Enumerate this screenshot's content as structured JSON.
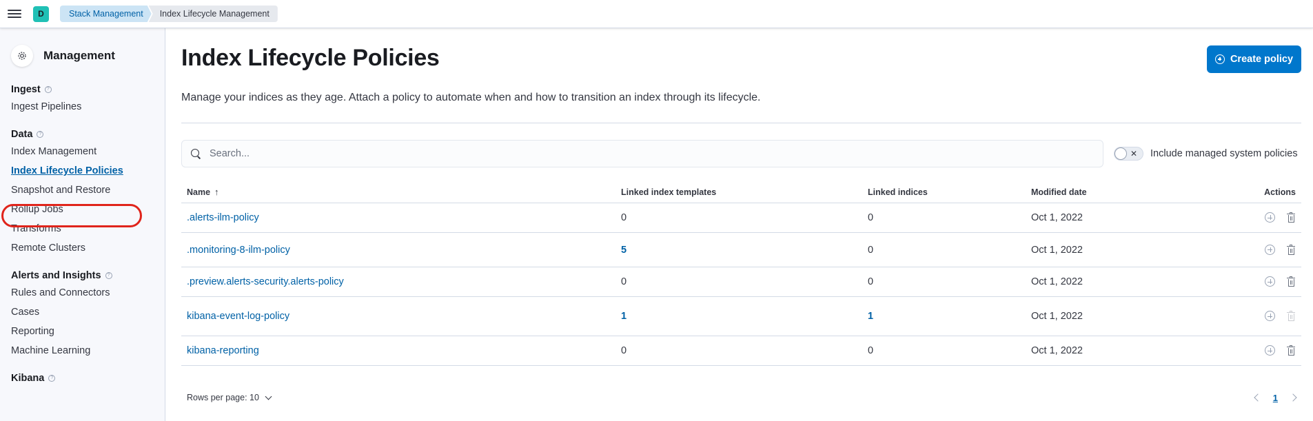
{
  "header": {
    "space_initial": "D",
    "breadcrumbs": [
      "Stack Management",
      "Index Lifecycle Management"
    ]
  },
  "sidebar": {
    "title": "Management",
    "groups": [
      {
        "title": "Ingest",
        "items": [
          "Ingest Pipelines"
        ]
      },
      {
        "title": "Data",
        "items": [
          "Index Management",
          "Index Lifecycle Policies",
          "Snapshot and Restore",
          "Rollup Jobs",
          "Transforms",
          "Remote Clusters"
        ]
      },
      {
        "title": "Alerts and Insights",
        "items": [
          "Rules and Connectors",
          "Cases",
          "Reporting",
          "Machine Learning"
        ]
      },
      {
        "title": "Kibana",
        "items": []
      }
    ],
    "active_item": "Index Lifecycle Policies"
  },
  "main": {
    "title": "Index Lifecycle Policies",
    "create_button": "Create policy",
    "description": "Manage your indices as they age. Attach a policy to automate when and how to transition an index through its lifecycle.",
    "search_placeholder": "Search...",
    "toggle_label": "Include managed system policies",
    "toggle_on": false,
    "columns": [
      "Name",
      "Linked index templates",
      "Linked indices",
      "Modified date",
      "Actions"
    ],
    "rows": [
      {
        "name": ".alerts-ilm-policy",
        "templates": "0",
        "indices": "0",
        "modified": "Oct 1, 2022",
        "delete_enabled": true
      },
      {
        "name": ".monitoring-8-ilm-policy",
        "templates": "5",
        "indices": "0",
        "modified": "Oct 1, 2022",
        "delete_enabled": true
      },
      {
        "name": ".preview.alerts-security.alerts-policy",
        "templates": "0",
        "indices": "0",
        "modified": "Oct 1, 2022",
        "delete_enabled": true
      },
      {
        "name": "kibana-event-log-policy",
        "templates": "1",
        "indices": "1",
        "modified": "Oct 1, 2022",
        "delete_enabled": false
      },
      {
        "name": "kibana-reporting",
        "templates": "0",
        "indices": "0",
        "modified": "Oct 1, 2022",
        "delete_enabled": true
      }
    ],
    "rows_per_page": "Rows per page: 10",
    "current_page": "1"
  },
  "colors": {
    "primary": "#0077cc",
    "link": "#0061a6",
    "highlight": "#e0241b"
  }
}
